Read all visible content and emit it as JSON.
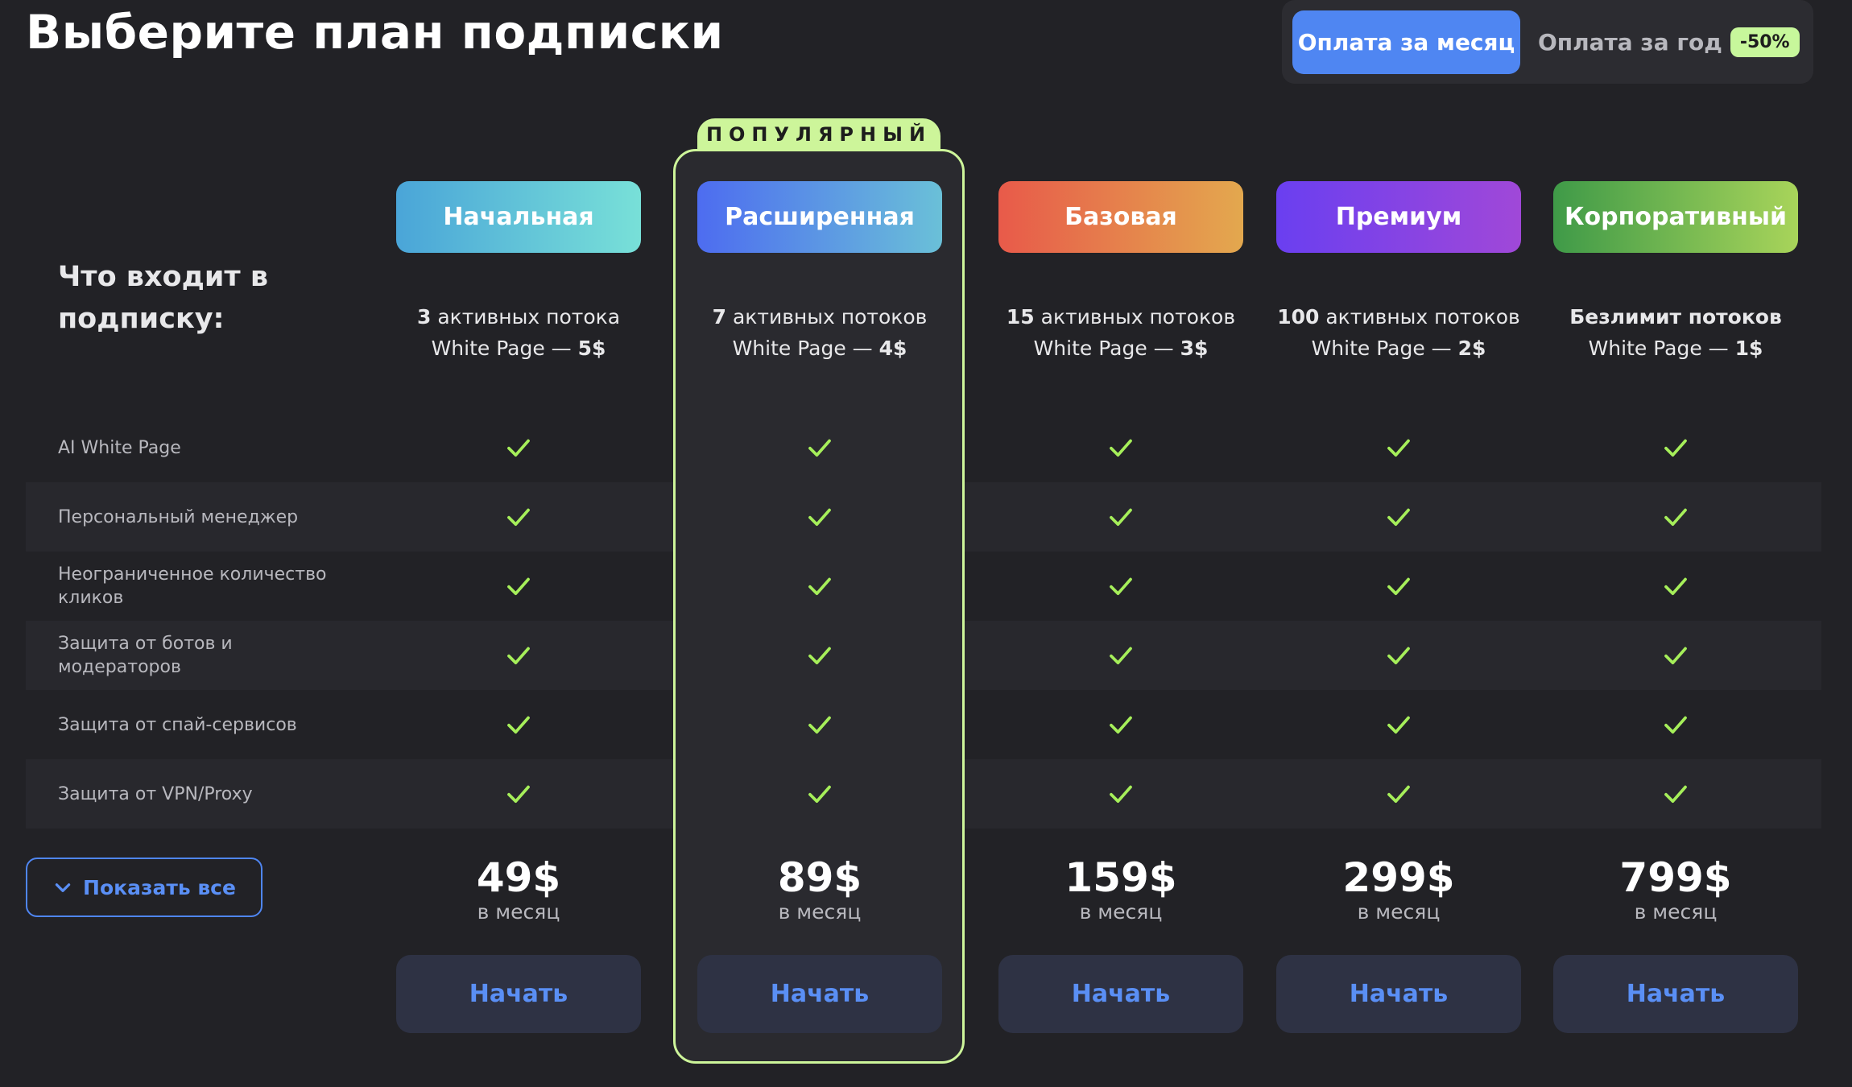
{
  "page": {
    "title": "Выберите план подписки"
  },
  "billing": {
    "monthly_label": "Оплата за месяц",
    "yearly_label": "Оплата за год",
    "discount": "-50%"
  },
  "popular_label": "ПОПУЛЯРНЫЙ",
  "features_heading": "Что входит в подписку:",
  "features": [
    "AI White Page",
    "Персональный менеджер",
    "Неограниченное количество кликов",
    "Защита от ботов и модераторов",
    "Защита от спай-сервисов",
    "Защита от VPN/Proxy"
  ],
  "plans": [
    {
      "name": "Начальная",
      "streams_count": "3",
      "streams_text": " активных потока",
      "wp_text": "White Page — ",
      "wp_price": "5$",
      "price": "49$",
      "period": "в месяц",
      "cta": "Начать"
    },
    {
      "name": "Расширенная",
      "streams_count": "7",
      "streams_text": " активных потоков",
      "wp_text": "White Page — ",
      "wp_price": "4$",
      "price": "89$",
      "period": "в месяц",
      "cta": "Начать"
    },
    {
      "name": "Базовая",
      "streams_count": "15",
      "streams_text": " активных потоков",
      "wp_text": "White Page — ",
      "wp_price": "3$",
      "price": "159$",
      "period": "в месяц",
      "cta": "Начать"
    },
    {
      "name": "Премиум",
      "streams_count": "100",
      "streams_text": " активных потоков",
      "wp_text": "White Page — ",
      "wp_price": "2$",
      "price": "299$",
      "period": "в месяц",
      "cta": "Начать"
    },
    {
      "name": "Корпоративный",
      "streams_count": "Безлимит потоков",
      "streams_text": "",
      "wp_text": "White Page — ",
      "wp_price": "1$",
      "price": "799$",
      "period": "в месяц",
      "cta": "Начать"
    }
  ],
  "show_all_label": "Показать все",
  "colors": {
    "accent_blue": "#4f86f2",
    "popular_green": "#cdf59a",
    "check_green": "#a6ef5a",
    "background": "#222226"
  },
  "icons": {
    "check": "check-icon",
    "chevron": "chevron-down-icon"
  }
}
